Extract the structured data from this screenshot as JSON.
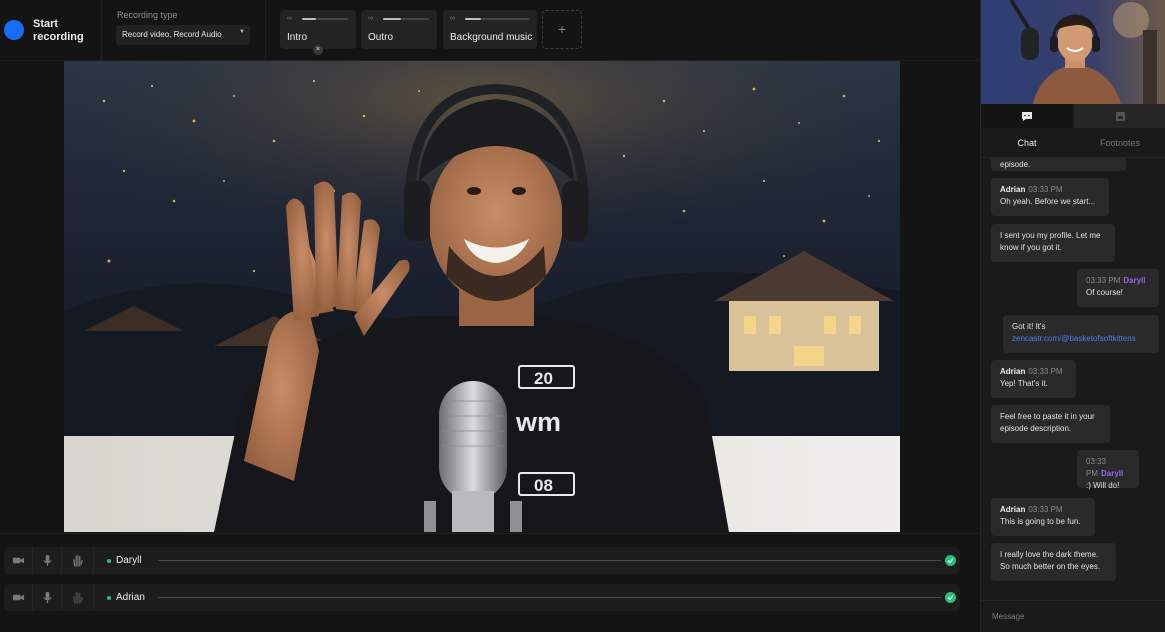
{
  "toolbar": {
    "record_label": "Start recording",
    "recording_type_title": "Recording type",
    "recording_type_value": "Record video, Record Audio",
    "clips": [
      {
        "name": "Intro",
        "progress": 0.3
      },
      {
        "name": "Outro",
        "progress": 0.4
      },
      {
        "name": "Background music",
        "progress": 0.25
      }
    ],
    "add_clip": "+",
    "remove_clip": "×"
  },
  "participants": [
    {
      "name": "Daryll",
      "status": "connected"
    },
    {
      "name": "Adrian",
      "status": "connected"
    }
  ],
  "sidebar": {
    "tabs": [
      {
        "label": "Chat",
        "active": true
      },
      {
        "label": "Footnotes",
        "active": false
      }
    ],
    "messages": {
      "m0": {
        "text": "episode."
      },
      "m1": {
        "author": "Adrian",
        "time": "03:33 PM",
        "text": "Oh yeah. Before we start..."
      },
      "m2": {
        "text": "I sent you my profile. Let me know if you got it."
      },
      "m3": {
        "author": "Daryll",
        "time": "03:33 PM",
        "text": "Of course!"
      },
      "m4": {
        "text": "Got it! It's",
        "link": "zencastr.com/@basketofsoftkittens"
      },
      "m5": {
        "author": "Adrian",
        "time": "03:33 PM",
        "text": "Yep! That's it."
      },
      "m6": {
        "text": "Feel free to paste it in your episode description."
      },
      "m7": {
        "author": "Daryll",
        "time": "03:33 PM",
        "text": ":) Will do!"
      },
      "m8": {
        "author": "Adrian",
        "time": "03:33 PM",
        "text": "This is going to be fun."
      },
      "m9": {
        "text": "I really love the dark theme. So much better on the eyes."
      }
    },
    "message_placeholder": "Message"
  },
  "colors": {
    "record": "#1a6cf6",
    "online": "#22c27a",
    "self_name": "#8e67f0",
    "link": "#4a7ff0"
  }
}
